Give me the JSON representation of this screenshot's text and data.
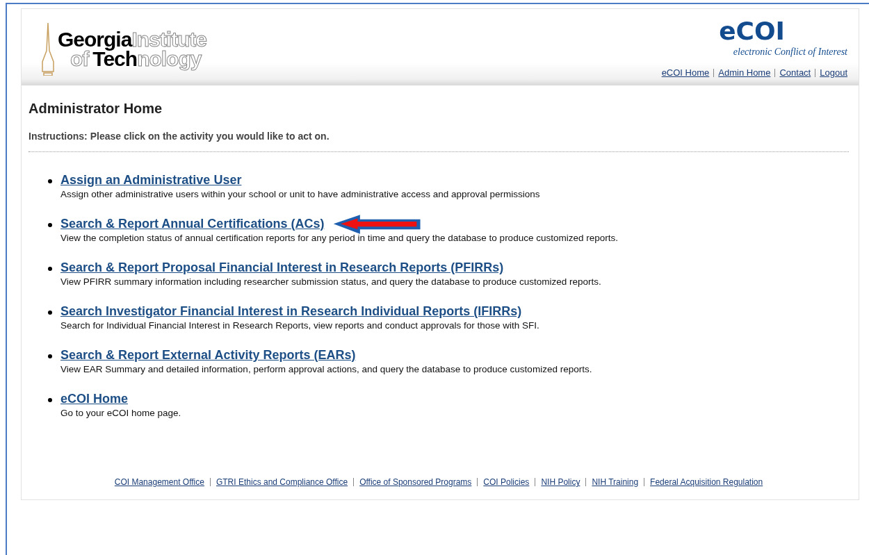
{
  "logo": {
    "lines": [
      [
        {
          "text": "Georgia",
          "kind": "solid"
        },
        {
          "text": "Institute",
          "kind": "outline"
        }
      ],
      [
        {
          "text": "of",
          "kind": "outline"
        },
        {
          "text": "Tech",
          "kind": "solid"
        },
        {
          "text": "nology",
          "kind": "outline"
        }
      ]
    ]
  },
  "brand": {
    "title": "eCOI",
    "subtitle": "electronic Conflict of Interest"
  },
  "top_links": [
    "eCOI Home",
    "Admin Home",
    "Contact",
    "Logout"
  ],
  "page_title": "Administrator Home",
  "instructions": "Instructions: Please click on the activity you would like to act on.",
  "activities": [
    {
      "title": "Assign an Administrative User",
      "description": "Assign other administrative users within your school or unit to have administrative access and approval permissions",
      "highlighted": false
    },
    {
      "title": "Search & Report Annual Certifications (ACs)",
      "description": "View the completion status of annual certification reports for any period in time and query the database to produce customized reports.",
      "highlighted": true
    },
    {
      "title": "Search & Report Proposal Financial Interest in Research Reports (PFIRRs)",
      "description": "View PFIRR summary information including researcher submission status, and query the database to produce customized reports.",
      "highlighted": false
    },
    {
      "title": "Search Investigator Financial Interest in Research Individual Reports (IFIRRs)",
      "description": "Search for Individual Financial Interest in Research Reports, view reports and conduct approvals for those with SFI.",
      "highlighted": false
    },
    {
      "title": "Search & Report External Activity Reports (EARs)",
      "description": "View EAR Summary and detailed information, perform approval actions, and query the database to produce customized reports.",
      "highlighted": false
    },
    {
      "title": "eCOI Home",
      "description": "Go to your eCOI home page.",
      "highlighted": false
    }
  ],
  "footer_links": [
    "COI Management Office",
    "GTRI Ethics and Compliance Office",
    "Office of Sponsored Programs",
    "COI Policies",
    "NIH Policy",
    "NIH Training",
    "Federal Acquisition Regulation"
  ]
}
